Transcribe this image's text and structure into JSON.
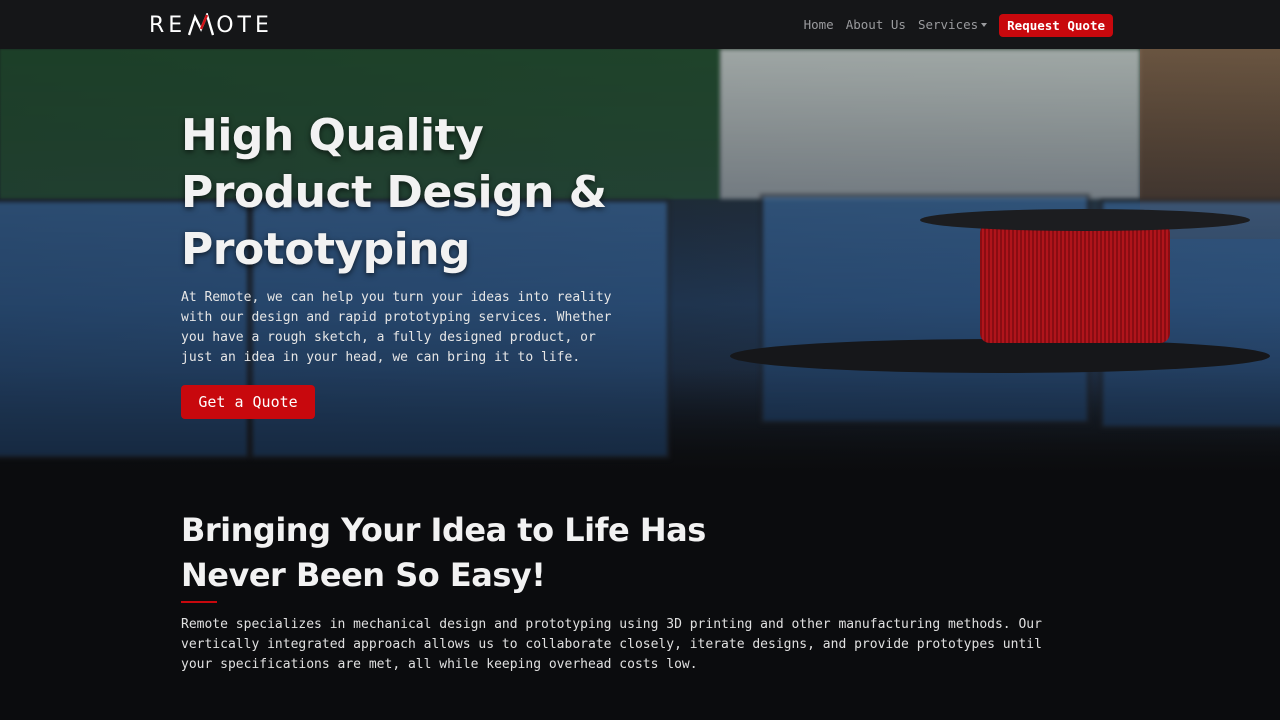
{
  "navbar": {
    "logo_text_left": "RE",
    "logo_text_right": "OTE",
    "links": [
      {
        "label": "Home"
      },
      {
        "label": "About Us"
      },
      {
        "label": "Services"
      }
    ],
    "cta_label": "Request Quote"
  },
  "hero": {
    "title": "High Quality Product Design & Prototyping",
    "text": "At Remote, we can help you turn your ideas into reality with our design and rapid prototyping services. Whether you have a rough sketch, a fully designed product, or just an idea in your head, we can bring it to life.",
    "button_label": "Get a Quote"
  },
  "intro": {
    "title": "Bringing Your Idea to Life Has Never Been So Easy!",
    "text": "Remote specializes in mechanical design and prototyping using 3D printing and other manufacturing methods. Our vertically integrated approach allows us to collaborate closely, iterate designs, and provide prototypes until your specifications are met, all while keeping overhead costs low."
  },
  "colors": {
    "accent": "#c8080d",
    "background": "#0b0c0e",
    "navbar": "#151618"
  }
}
